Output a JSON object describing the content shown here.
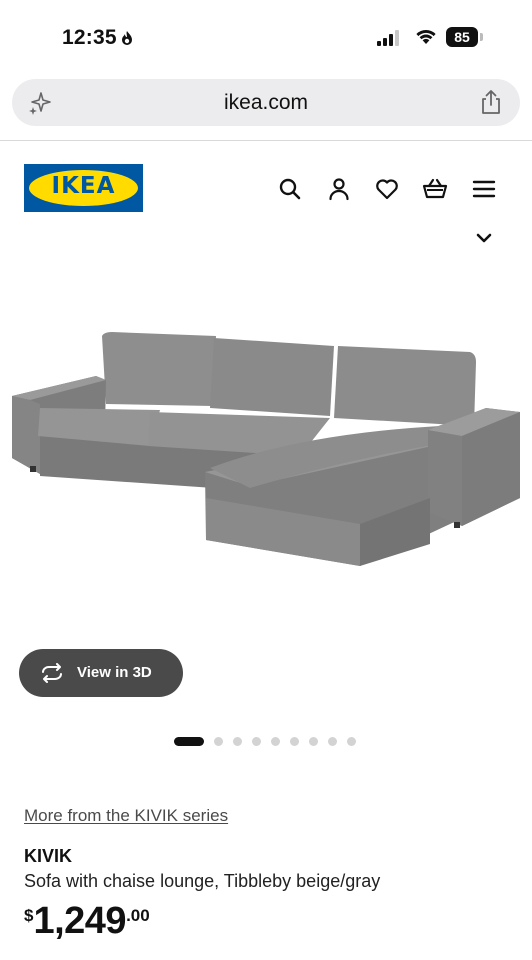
{
  "status_bar": {
    "time": "12:35",
    "battery": "85"
  },
  "browser": {
    "url": "ikea.com"
  },
  "header": {
    "logo_text": "IKEA",
    "brand_colors": {
      "blue": "#0058a3",
      "yellow": "#ffdb00"
    },
    "icons": [
      "search-icon",
      "account-icon",
      "favorites-icon",
      "cart-icon",
      "menu-icon"
    ]
  },
  "gallery": {
    "view_3d_label": "View in 3D",
    "total_images": 9,
    "active_index": 0
  },
  "product": {
    "series_link": "More from the KIVIK series",
    "name": "KIVIK",
    "description": "Sofa with chaise lounge, Tibbleby beige/gray",
    "price": {
      "currency": "$",
      "whole": "1,249",
      "cents": ".00"
    }
  }
}
